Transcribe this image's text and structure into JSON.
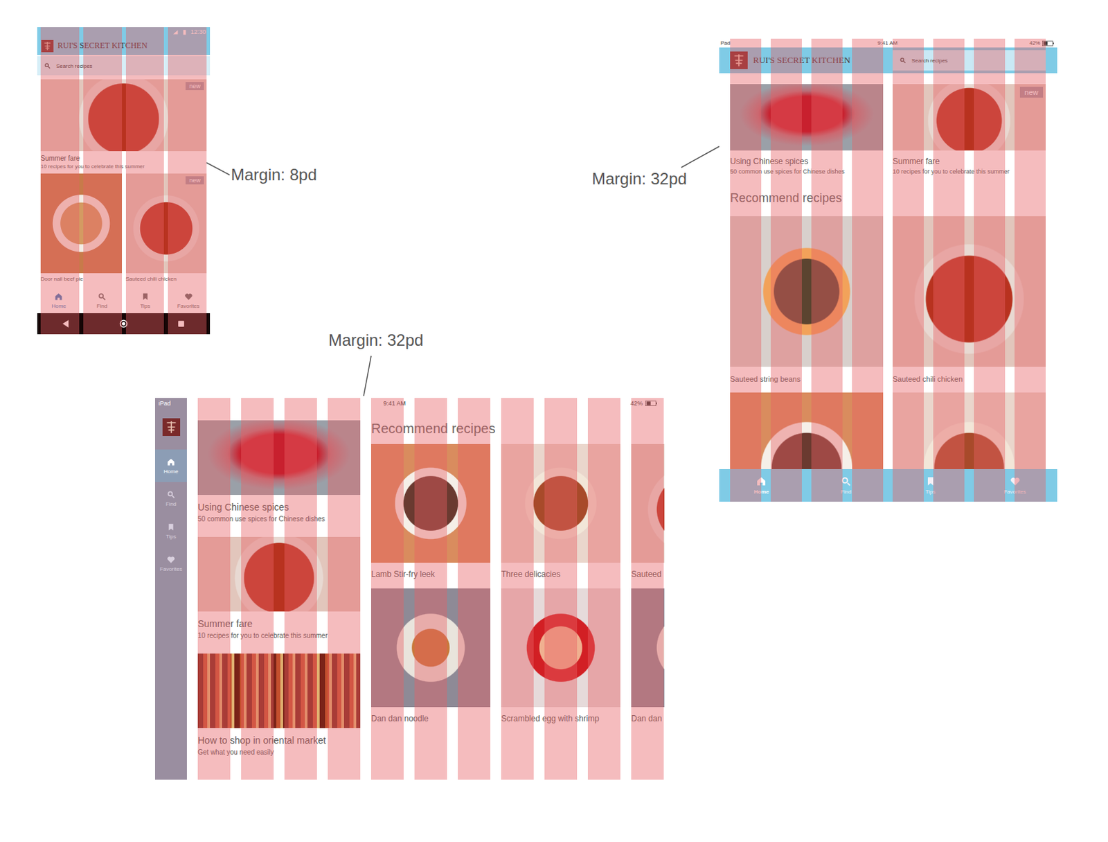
{
  "phone": {
    "annotation": "Margin: 8pd",
    "status_bar": {
      "time": "12:30"
    },
    "app_title": "RUI'S SECRET KITCHEN",
    "search": {
      "placeholder": "Search recipes"
    },
    "featured": {
      "title": "Summer fare",
      "subtitle": "10 recipes for you to celebrate this summer",
      "badge": "new"
    },
    "cards": [
      {
        "title": "Door nail beef pie"
      },
      {
        "title": "Sauteed chili chicken",
        "badge": "new"
      }
    ],
    "nav": [
      {
        "label": "Home",
        "selected": true
      },
      {
        "label": "Find",
        "selected": false
      },
      {
        "label": "Tips",
        "selected": false
      },
      {
        "label": "Favorites",
        "selected": false
      }
    ]
  },
  "tablet_landscape": {
    "annotation": "Margin: 32pd",
    "status_bar": {
      "device": "iPad",
      "time": "9:41 AM",
      "battery": "42%"
    },
    "rail": [
      {
        "label": "Home",
        "selected": true
      },
      {
        "label": "Find",
        "selected": false
      },
      {
        "label": "Tips",
        "selected": false
      },
      {
        "label": "Favorites",
        "selected": false
      }
    ],
    "articles": [
      {
        "title": "Using Chinese spices",
        "subtitle": "50 common use spices for Chinese dishes"
      },
      {
        "title": "Summer fare",
        "subtitle": "10 recipes for you to celebrate this summer"
      },
      {
        "title": "How to shop in oriental market",
        "subtitle": "Get what you need easily"
      }
    ],
    "section_title": "Recommend recipes",
    "recipes": [
      {
        "title": "Lamb Stir-fry leek"
      },
      {
        "title": "Three delicacies"
      },
      {
        "title": "Sauteed"
      },
      {
        "title": "Dan dan noodle"
      },
      {
        "title": "Scrambled egg with shrimp"
      },
      {
        "title": "Dan dan"
      }
    ]
  },
  "tablet_portrait": {
    "annotation": "Margin: 32pd",
    "status_bar": {
      "device": "Pad",
      "time": "9:41 AM",
      "battery": "42%"
    },
    "app_title": "RUI'S SECRET KITCHEN",
    "search": {
      "placeholder": "Search recipes"
    },
    "articles": [
      {
        "title": "Using Chinese spices",
        "subtitle": "50 common use spices for Chinese dishes"
      },
      {
        "title": "Summer fare",
        "subtitle": "10 recipes for you to celebrate this summer",
        "badge": "new"
      }
    ],
    "section_title": "Recommend recipes",
    "recipes": [
      {
        "title": "Sauteed string beans"
      },
      {
        "title": "Sauteed chili chicken"
      }
    ],
    "nav": [
      {
        "label": "Home",
        "selected": true
      },
      {
        "label": "Find",
        "selected": false
      },
      {
        "label": "Tips",
        "selected": false
      },
      {
        "label": "Favorites",
        "selected": false
      }
    ]
  }
}
